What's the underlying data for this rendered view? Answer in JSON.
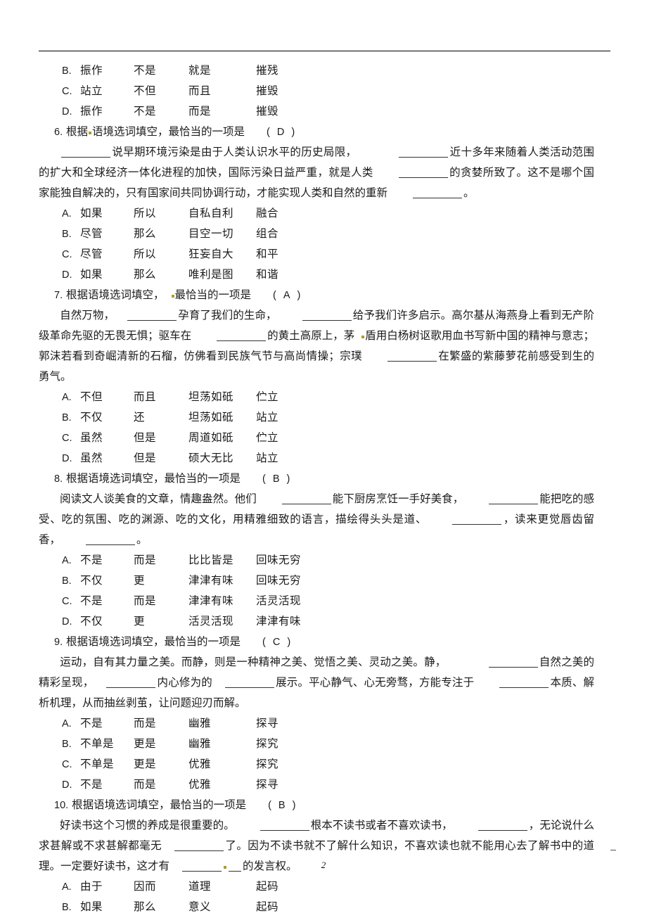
{
  "document": {
    "page_number": "2",
    "header_rule": true
  },
  "carryover_options": [
    {
      "letter": "B.",
      "c1": "振作",
      "c2": "不是",
      "c3": "就是",
      "c4": "摧残"
    },
    {
      "letter": "C.",
      "c1": "站立",
      "c2": "不但",
      "c3": "而且",
      "c4": "摧毁"
    },
    {
      "letter": "D.",
      "c1": "振作",
      "c2": "不是",
      "c3": "而是",
      "c4": "摧毁"
    }
  ],
  "questions": [
    {
      "number": "6.",
      "stem_a": "根据",
      "stem_b": "语境选词填空，最恰当的一项是",
      "paren_open": "(",
      "answer": "D",
      "paren_close": ")",
      "passage": {
        "seg1": "说早期环境污染是由于人类认识水平的历史局限，",
        "seg2": "近十多年来随着人类活动范围的扩大和全球经济一体化进程的加快，国际污染日益严重，就是人类",
        "seg3": "的贪婪所致了。这不是哪个国家能独自解决的，只有国家间共同协调行动，才能实现人类和自然的重新",
        "seg4": "。"
      },
      "options": [
        {
          "letter": "A.",
          "c1": "如果",
          "c2": "所以",
          "c3": "自私自利",
          "c4": "融合"
        },
        {
          "letter": "B.",
          "c1": "尽管",
          "c2": "那么",
          "c3": "目空一切",
          "c4": "组合"
        },
        {
          "letter": "C.",
          "c1": "尽管",
          "c2": "所以",
          "c3": "狂妄自大",
          "c4": "和平"
        },
        {
          "letter": "D.",
          "c1": "如果",
          "c2": "那么",
          "c3": "唯利是图",
          "c4": "和谐"
        }
      ]
    },
    {
      "number": "7.",
      "stem_a": "根据语境选词填空，",
      "stem_b": "最恰当的一项是",
      "paren_open": "(",
      "answer": "A",
      "paren_close": ")",
      "passage": {
        "seg1": "自然万物，",
        "seg2": "孕育了我们的生命，",
        "seg3": "给予我们许多启示。高尔基从海燕身上看到无产阶级革命先驱的无畏无惧；驱车在",
        "seg4": "的黄土高原上，茅",
        "seg5": "盾用白杨树讴歌用血书写新中国的精神与意志；郭沫若看到奇崛清新的石榴，仿佛看到民族气节与高尚情操；宗璞",
        "seg6": "在繁盛的紫藤萝花前感受到生的勇气。"
      },
      "options": [
        {
          "letter": "A.",
          "c1": "不但",
          "c2": "而且",
          "c3": "坦荡如砥",
          "c4": "伫立"
        },
        {
          "letter": "B.",
          "c1": "不仅",
          "c2": "还",
          "c3": "坦荡如砥",
          "c4": "站立"
        },
        {
          "letter": "C.",
          "c1": "虽然",
          "c2": "但是",
          "c3": "周道如砥",
          "c4": "伫立"
        },
        {
          "letter": "D.",
          "c1": "虽然",
          "c2": "但是",
          "c3": "硕大无比",
          "c4": "站立"
        }
      ]
    },
    {
      "number": "8.",
      "stem_a": "根据语境选词填空，最恰当的一项是",
      "stem_b": "",
      "paren_open": "(",
      "answer": "B",
      "paren_close": ")",
      "passage": {
        "seg1": "阅读文人谈美食的文章，情趣盎然。他们",
        "seg2": "能下厨房烹饪一手好美食，",
        "seg3": "能把吃的感受、吃的氛围、吃的渊源、吃的文化，用精雅细致的语言，描绘得头头是道、",
        "seg4": "，读来更觉唇齿留香，",
        "seg5": "。"
      },
      "options": [
        {
          "letter": "A.",
          "c1": "不是",
          "c2": "而是",
          "c3": "比比皆是",
          "c4": "回味无穷"
        },
        {
          "letter": "B.",
          "c1": "不仅",
          "c2": "更",
          "c3": "津津有味",
          "c4": "回味无穷"
        },
        {
          "letter": "C.",
          "c1": "不是",
          "c2": "而是",
          "c3": "津津有味",
          "c4": "活灵活现"
        },
        {
          "letter": "D.",
          "c1": "不仅",
          "c2": "更",
          "c3": "活灵活现",
          "c4": "津津有味"
        }
      ]
    },
    {
      "number": "9.",
      "stem_a": "根据语境选词填空，最恰当的一项是",
      "stem_b": "",
      "paren_open": "(",
      "answer": "C",
      "paren_close": ")",
      "passage": {
        "seg1": "运动，自有其力量之美。而静，则是一种精神之美、觉悟之美、灵动之美。静，",
        "seg2": "自然之美的精彩呈现，",
        "seg3": "内心修为的",
        "seg4": "展示。平心静气、心无旁骛，方能专注于",
        "seg5": "本质、解析机理，从而抽丝剥茧，让问题迎刃而解。"
      },
      "options": [
        {
          "letter": "A.",
          "c1": "不是",
          "c2": "而是",
          "c3": "幽雅",
          "c4": "探寻"
        },
        {
          "letter": "B.",
          "c1": "不单是",
          "c2": "更是",
          "c3": "幽雅",
          "c4": "探究"
        },
        {
          "letter": "C.",
          "c1": "不单是",
          "c2": "更是",
          "c3": "优雅",
          "c4": "探究"
        },
        {
          "letter": "D.",
          "c1": "不是",
          "c2": "而是",
          "c3": "优雅",
          "c4": "探寻"
        }
      ]
    },
    {
      "number": "10.",
      "stem_a": "根据语境选词填空，最恰当的一项是",
      "stem_b": "",
      "paren_open": "(",
      "answer": "B",
      "paren_close": ")",
      "passage": {
        "seg1": "好读书这个习惯的养成是很重要的。",
        "seg2": "根本不读书或者不喜欢读书，",
        "seg3": "，无论说什么求甚解或不求甚解都毫无",
        "seg4": "了。因为不读书就不了解什么知识，不喜欢读也就不能用心去了解书中的道理。一定要好读书，这才有",
        "seg5": "的发言权。"
      },
      "options": [
        {
          "letter": "A.",
          "c1": "由于",
          "c2": "因而",
          "c3": "道理",
          "c4": "起码"
        },
        {
          "letter": "B.",
          "c1": "如果",
          "c2": "那么",
          "c3": "意义",
          "c4": "起码"
        }
      ]
    }
  ]
}
